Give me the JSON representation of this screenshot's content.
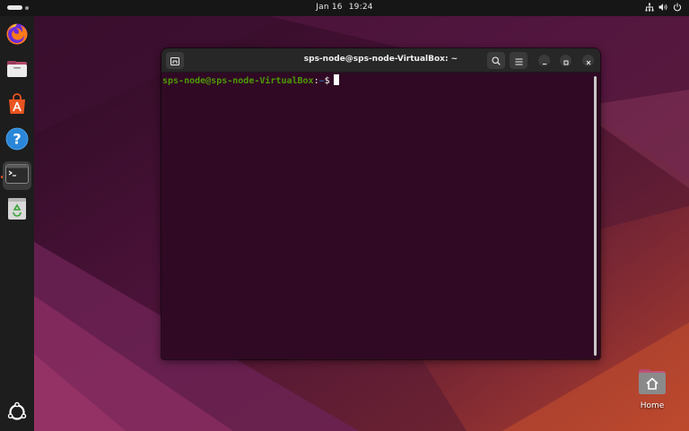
{
  "topbar": {
    "date": "Jan 16",
    "time": "19:24",
    "tray_icons": [
      "network-icon",
      "volume-icon",
      "power-icon"
    ]
  },
  "dock": {
    "items": [
      {
        "name": "firefox",
        "icon": "firefox-icon"
      },
      {
        "name": "files",
        "icon": "files-icon"
      },
      {
        "name": "app-center",
        "icon": "app-center-icon"
      },
      {
        "name": "help",
        "icon": "help-icon"
      },
      {
        "name": "terminal",
        "icon": "terminal-icon",
        "active": true
      },
      {
        "name": "trash",
        "icon": "trash-icon"
      }
    ],
    "show_apps_icon": "ubuntu-logo-icon"
  },
  "terminal": {
    "title": "sps-node@sps-node-VirtualBox: ~",
    "prompt_user_host": "sps-node@sps-node-VirtualBox",
    "prompt_sep": ":",
    "prompt_path": "~",
    "prompt_symbol": "$",
    "colors": {
      "background": "#300a24",
      "user": "#4e9a06",
      "path": "#3465a4"
    }
  },
  "desktop": {
    "home_label": "Home"
  }
}
